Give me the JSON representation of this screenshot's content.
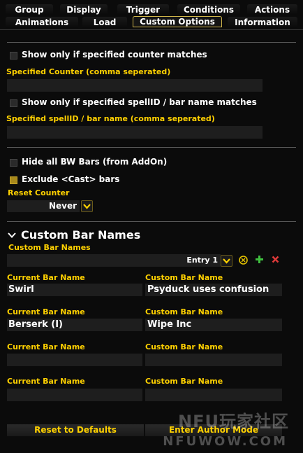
{
  "tabs_row1": [
    "Group",
    "Display",
    "Trigger",
    "Conditions",
    "Actions"
  ],
  "tabs_row2": [
    "Animations",
    "Load",
    "Custom Options",
    "Information"
  ],
  "options": {
    "counter_match": "Show only if specified counter matches",
    "specified_counter": "Specified Counter (comma seperated)",
    "spell_match": "Show only if specified spellID / bar name matches",
    "specified_spell": "Specified spellID / bar name (comma seperated)",
    "hide_bw": "Hide all BW Bars (from AddOn)",
    "exclude_cast": "Exclude <Cast> bars",
    "reset_counter": "Reset Counter",
    "reset_value": "Never"
  },
  "custom_bar_names": {
    "section_title": "Custom Bar Names",
    "field_label": "Custom Bar Names",
    "entry": "Entry 1",
    "current_label": "Current Bar Name",
    "custom_label": "Custom Bar Name",
    "rows": [
      {
        "current": "Swirl",
        "custom": "Psyduck uses confusion"
      },
      {
        "current": "Berserk (I)",
        "custom": "Wipe Inc"
      },
      {
        "current": "",
        "custom": ""
      },
      {
        "current": "",
        "custom": ""
      }
    ]
  },
  "buttons": {
    "reset_defaults": "Reset to Defaults",
    "author_mode": "Enter Author Mode"
  },
  "watermark": {
    "line1": "NFU玩家社区",
    "line2": "NFUWOW.COM"
  },
  "colors": {
    "gold": "#ffd100",
    "active_tab_border": "#cfb54a",
    "add_green": "#3fbf3f",
    "delete_red": "#e23a3a"
  }
}
